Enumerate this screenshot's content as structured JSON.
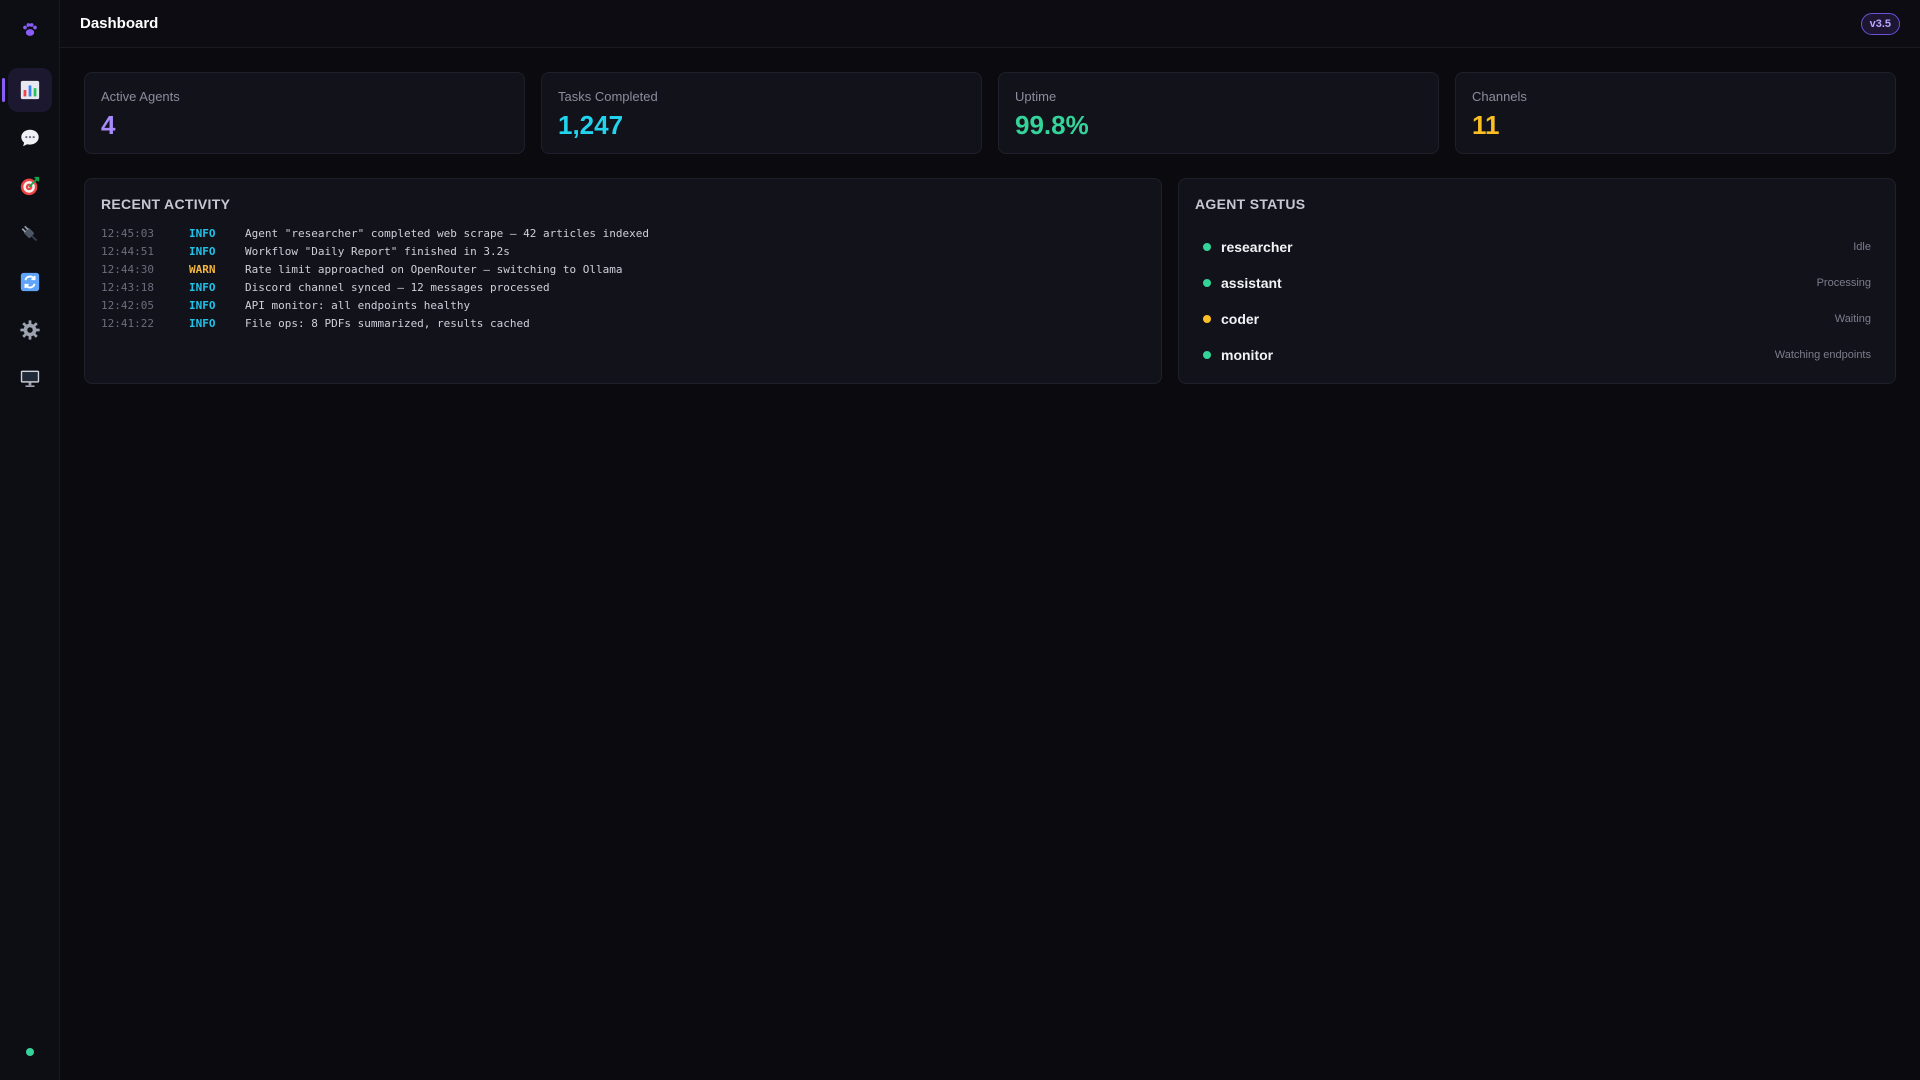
{
  "header": {
    "title": "Dashboard",
    "version": "v3.5"
  },
  "sidebar": {
    "logo_icon": "paw-icon",
    "items": [
      {
        "icon": "bar-chart-icon",
        "active": true
      },
      {
        "icon": "chat-bubble-icon",
        "active": false
      },
      {
        "icon": "target-icon",
        "active": false
      },
      {
        "icon": "plug-icon",
        "active": false
      },
      {
        "icon": "refresh-icon",
        "active": false
      },
      {
        "icon": "gear-icon",
        "active": false
      },
      {
        "icon": "monitor-icon",
        "active": false
      }
    ],
    "status_color": "#34d399"
  },
  "stats": [
    {
      "label": "Active Agents",
      "value": "4",
      "color": "#a78bfa"
    },
    {
      "label": "Tasks Completed",
      "value": "1,247",
      "color": "#22d3ee"
    },
    {
      "label": "Uptime",
      "value": "99.8%",
      "color": "#34d399"
    },
    {
      "label": "Channels",
      "value": "11",
      "color": "#fbbf24"
    }
  ],
  "activity": {
    "title": "RECENT ACTIVITY",
    "rows": [
      {
        "time": "12:45:03",
        "level": "INFO",
        "message": "Agent \"researcher\" completed web scrape — 42 articles indexed"
      },
      {
        "time": "12:44:51",
        "level": "INFO",
        "message": "Workflow \"Daily Report\" finished in 3.2s"
      },
      {
        "time": "12:44:30",
        "level": "WARN",
        "message": "Rate limit approached on OpenRouter — switching to Ollama"
      },
      {
        "time": "12:43:18",
        "level": "INFO",
        "message": "Discord channel synced — 12 messages processed"
      },
      {
        "time": "12:42:05",
        "level": "INFO",
        "message": "API monitor: all endpoints healthy"
      },
      {
        "time": "12:41:22",
        "level": "INFO",
        "message": "File ops: 8 PDFs summarized, results cached"
      }
    ]
  },
  "agent_status": {
    "title": "AGENT STATUS",
    "agents": [
      {
        "name": "researcher",
        "status": "Idle",
        "color": "#34d399"
      },
      {
        "name": "assistant",
        "status": "Processing",
        "color": "#34d399"
      },
      {
        "name": "coder",
        "status": "Waiting",
        "color": "#fbbf24"
      },
      {
        "name": "monitor",
        "status": "Watching endpoints",
        "color": "#34d399"
      }
    ]
  }
}
